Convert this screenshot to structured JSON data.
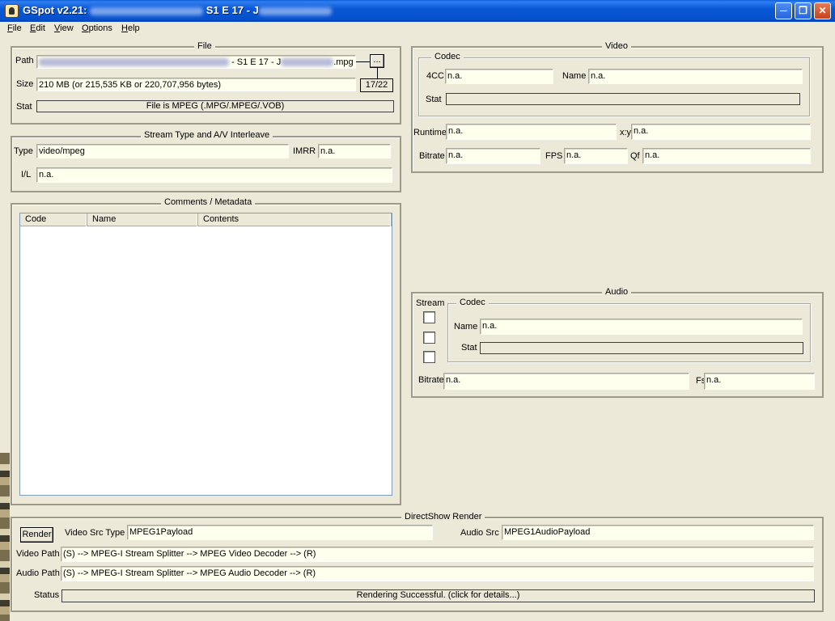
{
  "title": {
    "app": "GSpot v2.21:",
    "episode": "S1 E 17 -",
    "initial": "J"
  },
  "menu": [
    "File",
    "Edit",
    "View",
    "Options",
    "Help"
  ],
  "file_group": {
    "legend": "File",
    "path_label": "Path",
    "path_value_visible": "- S1 E 17 - J",
    "path_suffix": ".mpg",
    "browse_label": "...",
    "counter": "17/22",
    "size_label": "Size",
    "size_value": "210 MB (or 215,535 KB or 220,707,956 bytes)",
    "stat_label": "Stat",
    "stat_value": "File is MPEG (.MPG/.MPEG/.VOB)"
  },
  "stream_group": {
    "legend": "Stream Type and A/V Interleave",
    "type_label": "Type",
    "type_value": "video/mpeg",
    "imrr_label": "IMRR",
    "imrr_value": "n.a.",
    "il_label": "I/L",
    "il_value": "n.a."
  },
  "comments_group": {
    "legend": "Comments / Metadata",
    "columns": [
      "Code",
      "Name",
      "Contents"
    ]
  },
  "video_group": {
    "legend": "Video",
    "codec_legend": "Codec",
    "fourcc_label": "4CC",
    "fourcc_value": "n.a.",
    "name_label": "Name",
    "name_value": "n.a.",
    "stat_label": "Stat",
    "stat_value": "",
    "runtime_label": "Runtime",
    "runtime_value": "n.a.",
    "xy_label": "x:y",
    "xy_value": "n.a.",
    "bitrate_label": "Bitrate",
    "bitrate_value": "n.a.",
    "fps_label": "FPS",
    "fps_value": "n.a.",
    "qf_label": "Qf",
    "qf_value": "n.a."
  },
  "audio_group": {
    "legend": "Audio",
    "stream_label": "Stream",
    "codec_legend": "Codec",
    "name_label": "Name",
    "name_value": "n.a.",
    "stat_label": "Stat",
    "stat_value": "",
    "bitrate_label": "Bitrate",
    "bitrate_value": "n.a.",
    "fs_label": "Fs",
    "fs_value": "n.a."
  },
  "directshow_group": {
    "legend": "DirectShow Render",
    "render_button": "Render",
    "video_src_label": "Video Src Type",
    "video_src_value": "MPEG1Payload",
    "audio_src_label": "Audio Src",
    "audio_src_value": "MPEG1AudioPayload",
    "video_path_label": "Video Path",
    "video_path_value": "(S) --> MPEG-I Stream Splitter --> MPEG Video Decoder --> (R)",
    "audio_path_label": "Audio Path",
    "audio_path_value": "(S) --> MPEG-I Stream Splitter --> MPEG Audio Decoder --> (R)",
    "status_label": "Status",
    "status_value": "Rendering Successful.  (click for details...)"
  }
}
